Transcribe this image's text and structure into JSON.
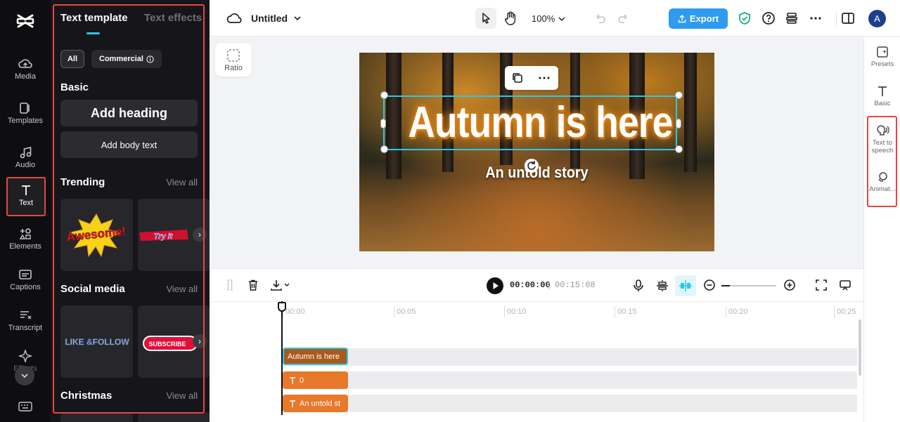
{
  "left_rail": {
    "items": [
      {
        "label": "Media",
        "icon": "media-cloud-icon"
      },
      {
        "label": "Templates",
        "icon": "templates-icon"
      },
      {
        "label": "Audio",
        "icon": "music-note-icon"
      },
      {
        "label": "Text",
        "icon": "text-t-icon",
        "active": true
      },
      {
        "label": "Elements",
        "icon": "elements-icon"
      },
      {
        "label": "Captions",
        "icon": "captions-icon"
      },
      {
        "label": "Transcript",
        "icon": "transcript-icon"
      },
      {
        "label": "Effects",
        "icon": "effects-star-icon"
      }
    ]
  },
  "panel": {
    "tabs": [
      "Text template",
      "Text effects"
    ],
    "filters": {
      "all": "All",
      "commercial": "Commercial"
    },
    "basic": {
      "title": "Basic",
      "add_heading": "Add heading",
      "add_body": "Add body text"
    },
    "trending": {
      "title": "Trending",
      "view_all": "View all",
      "cards": [
        "Awesome!",
        "Try it"
      ]
    },
    "social": {
      "title": "Social media",
      "view_all": "View all",
      "cards": [
        "LIKE &FOLLOW",
        "SUBSCRIBE"
      ]
    },
    "christmas": {
      "title": "Christmas",
      "view_all": "View all"
    }
  },
  "topbar": {
    "project_title": "Untitled",
    "zoom": "100%",
    "export_label": "Export",
    "avatar_initial": "A"
  },
  "stage": {
    "ratio_label": "Ratio",
    "canvas_title": "Autumn is here",
    "canvas_subtitle": "An untold story"
  },
  "right_rail": {
    "items": [
      "Presets",
      "Basic",
      "Text to speech",
      "Animat..."
    ]
  },
  "timeline": {
    "current_time": "00:00:00",
    "separator": "|",
    "total_time": "00:15:08",
    "ruler": [
      "00:00",
      "00:05",
      "00:10",
      "00:15",
      "00:20",
      "00:25"
    ],
    "clips": [
      {
        "label": "Autumn is here",
        "selected": true
      },
      {
        "label": "0",
        "selected": false
      },
      {
        "label": "An untold st",
        "selected": false
      }
    ]
  },
  "colors": {
    "accent": "#2ec6e6",
    "highlight_border": "#e84545",
    "export": "#2e9af0",
    "clip": "#e8782a"
  }
}
